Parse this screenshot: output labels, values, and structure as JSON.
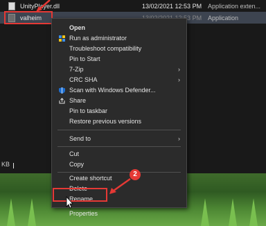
{
  "explorer": {
    "files": [
      {
        "name": "UnityPlayer.dll",
        "date": "13/02/2021 12:53 PM",
        "type": "Application exten..."
      },
      {
        "name": "valheim",
        "date": "13/02/2021 12:53 PM",
        "type": "Application"
      }
    ],
    "status_text": "KB"
  },
  "context_menu": {
    "items": [
      {
        "label": "Open",
        "bold": true,
        "icon": "",
        "submenu": false
      },
      {
        "label": "Run as administrator",
        "icon": "shield-icon",
        "submenu": false
      },
      {
        "label": "Troubleshoot compatibility",
        "icon": "",
        "submenu": false
      },
      {
        "label": "Pin to Start",
        "icon": "",
        "submenu": false
      },
      {
        "label": "7-Zip",
        "icon": "",
        "submenu": true
      },
      {
        "label": "CRC SHA",
        "icon": "",
        "submenu": true
      },
      {
        "label": "Scan with Windows Defender...",
        "icon": "defender-icon",
        "submenu": false
      },
      {
        "label": "Share",
        "icon": "share-icon",
        "submenu": false
      },
      {
        "label": "Pin to taskbar",
        "icon": "",
        "submenu": false
      },
      {
        "label": "Restore previous versions",
        "icon": "",
        "submenu": false
      },
      {
        "label": "Send to",
        "icon": "",
        "submenu": true
      },
      {
        "label": "Cut",
        "icon": "",
        "submenu": false
      },
      {
        "label": "Copy",
        "icon": "",
        "submenu": false
      },
      {
        "label": "Create shortcut",
        "icon": "",
        "submenu": false
      },
      {
        "label": "Delete",
        "icon": "",
        "submenu": false
      },
      {
        "label": "Rename",
        "icon": "",
        "submenu": false
      },
      {
        "label": "Properties",
        "icon": "",
        "submenu": false
      }
    ],
    "submenu_arrow": "›"
  },
  "annotation": {
    "step_number": "2",
    "color": "#e53935"
  }
}
